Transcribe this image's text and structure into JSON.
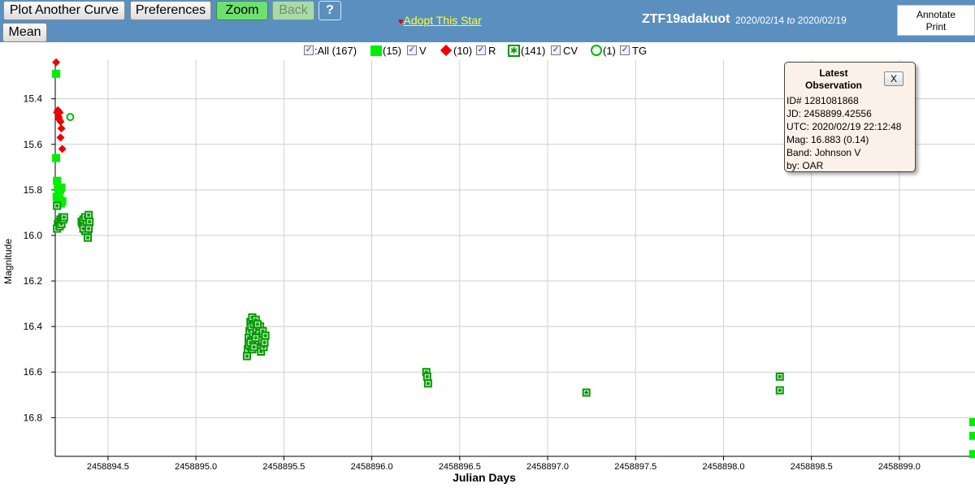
{
  "toolbar": {
    "plot_another": "Plot Another Curve",
    "preferences": "Preferences",
    "zoom": "Zoom",
    "back": "Back",
    "help": "?",
    "mean": "Mean",
    "adopt_heart": "♥",
    "adopt": "Adopt This Star",
    "star_name": "ZTF19adakuot",
    "date_from": "2020/02/14",
    "date_to_word": "to",
    "date_to": "2020/02/19",
    "annotate": "Annotate",
    "print": "Print"
  },
  "legend": {
    "all_label": ":All (167)",
    "items": [
      {
        "count": "(15)",
        "band": "V",
        "color": "#00ee00",
        "icon": "filled-square-icon"
      },
      {
        "count": "(10)",
        "band": "R",
        "color": "#ee0000",
        "icon": "red-diamond-icon"
      },
      {
        "count": "(141)",
        "band": "CV",
        "color": "#009900",
        "icon": "star-square-icon"
      },
      {
        "count": "(1)",
        "band": "TG",
        "color": "#00bb00",
        "icon": "open-circle-icon"
      }
    ]
  },
  "popup": {
    "title_line1": "Latest",
    "title_line2": "Observation",
    "close": "X",
    "lines": [
      "ID# 1281081868",
      "JD: 2458899.42556",
      "UTC: 2020/02/19 22:12:48",
      "Mag: 16.883 (0.14)",
      "Band: Johnson V",
      "by: OAR"
    ]
  },
  "chart_data": {
    "type": "scatter",
    "xlabel": "Julian Days",
    "ylabel": "Magnitude",
    "xlim": [
      2458894.2,
      2458899.43
    ],
    "ylim": [
      16.97,
      15.23
    ],
    "y_inverted": true,
    "grid": true,
    "x_ticks": [
      "2458894.5",
      "2458895.0",
      "2458895.5",
      "2458896.0",
      "2458896.5",
      "2458897.0",
      "2458897.5",
      "2458898.0",
      "2458898.5",
      "2458899.0"
    ],
    "x_tick_values": [
      2458894.5,
      2458895.0,
      2458895.5,
      2458896.0,
      2458896.5,
      2458897.0,
      2458897.5,
      2458898.0,
      2458898.5,
      2458899.0
    ],
    "y_ticks": [
      "15.4",
      "15.6",
      "15.8",
      "16.0",
      "16.2",
      "16.4",
      "16.6",
      "16.8"
    ],
    "y_tick_values": [
      15.4,
      15.6,
      15.8,
      16.0,
      16.2,
      16.4,
      16.6,
      16.8
    ],
    "series": [
      {
        "name": "V",
        "marker": "square",
        "color": "#00ee00",
        "points": [
          [
            2458894.205,
            15.29
          ],
          [
            2458894.205,
            15.66
          ],
          [
            2458894.21,
            15.76
          ],
          [
            2458894.215,
            15.79
          ],
          [
            2458894.22,
            15.82
          ],
          [
            2458894.225,
            15.84
          ],
          [
            2458894.235,
            15.79
          ],
          [
            2458894.24,
            15.85
          ],
          [
            2458894.208,
            15.83
          ],
          [
            2458894.212,
            15.86
          ],
          [
            2458894.228,
            15.8
          ],
          [
            2458894.232,
            15.86
          ],
          [
            2458899.42,
            16.82
          ],
          [
            2458899.42,
            16.88
          ],
          [
            2458899.42,
            16.96
          ]
        ]
      },
      {
        "name": "R",
        "marker": "diamond",
        "color": "#ee0000",
        "points": [
          [
            2458894.205,
            15.24
          ],
          [
            2458894.21,
            15.46
          ],
          [
            2458894.215,
            15.45
          ],
          [
            2458894.22,
            15.48
          ],
          [
            2458894.222,
            15.49
          ],
          [
            2458894.225,
            15.46
          ],
          [
            2458894.23,
            15.5
          ],
          [
            2458894.235,
            15.53
          ],
          [
            2458894.23,
            15.57
          ],
          [
            2458894.24,
            15.62
          ]
        ]
      },
      {
        "name": "CV",
        "marker": "star-square",
        "color": "#009900",
        "points": [
          [
            2458894.21,
            15.87
          ],
          [
            2458894.215,
            15.95
          ],
          [
            2458894.21,
            15.97
          ],
          [
            2458894.22,
            15.94
          ],
          [
            2458894.225,
            15.96
          ],
          [
            2458894.23,
            15.93
          ],
          [
            2458894.235,
            15.95
          ],
          [
            2458894.24,
            15.92
          ],
          [
            2458894.245,
            15.93
          ],
          [
            2458894.25,
            15.92
          ],
          [
            2458894.35,
            15.94
          ],
          [
            2458894.355,
            15.95
          ],
          [
            2458894.36,
            15.93
          ],
          [
            2458894.365,
            15.96
          ],
          [
            2458894.37,
            15.92
          ],
          [
            2458894.375,
            15.97
          ],
          [
            2458894.38,
            15.95
          ],
          [
            2458894.385,
            15.99
          ],
          [
            2458894.39,
            15.91
          ],
          [
            2458894.395,
            15.94
          ],
          [
            2458894.385,
            16.01
          ],
          [
            2458894.37,
            15.98
          ],
          [
            2458894.36,
            15.97
          ],
          [
            2458894.39,
            15.97
          ],
          [
            2458895.29,
            16.53
          ],
          [
            2458895.295,
            16.5
          ],
          [
            2458895.3,
            16.45
          ],
          [
            2458895.305,
            16.42
          ],
          [
            2458895.31,
            16.38
          ],
          [
            2458895.315,
            16.4
          ],
          [
            2458895.32,
            16.36
          ],
          [
            2458895.325,
            16.43
          ],
          [
            2458895.33,
            16.39
          ],
          [
            2458895.335,
            16.46
          ],
          [
            2458895.34,
            16.37
          ],
          [
            2458895.345,
            16.41
          ],
          [
            2458895.35,
            16.44
          ],
          [
            2458895.355,
            16.48
          ],
          [
            2458895.36,
            16.43
          ],
          [
            2458895.365,
            16.4
          ],
          [
            2458895.37,
            16.51
          ],
          [
            2458895.375,
            16.46
          ],
          [
            2458895.38,
            16.42
          ],
          [
            2458895.385,
            16.49
          ],
          [
            2458895.39,
            16.47
          ],
          [
            2458895.395,
            16.44
          ],
          [
            2458895.3,
            16.48
          ],
          [
            2458895.31,
            16.47
          ],
          [
            2458895.32,
            16.5
          ],
          [
            2458895.33,
            16.49
          ],
          [
            2458895.34,
            16.45
          ],
          [
            2458895.35,
            16.39
          ],
          [
            2458896.31,
            16.6
          ],
          [
            2458896.315,
            16.62
          ],
          [
            2458896.32,
            16.65
          ],
          [
            2458897.22,
            16.69
          ],
          [
            2458898.32,
            16.62
          ],
          [
            2458898.32,
            16.68
          ]
        ]
      },
      {
        "name": "TG",
        "marker": "open-circle",
        "color": "#00bb00",
        "points": [
          [
            2458894.285,
            15.48
          ]
        ]
      }
    ]
  }
}
